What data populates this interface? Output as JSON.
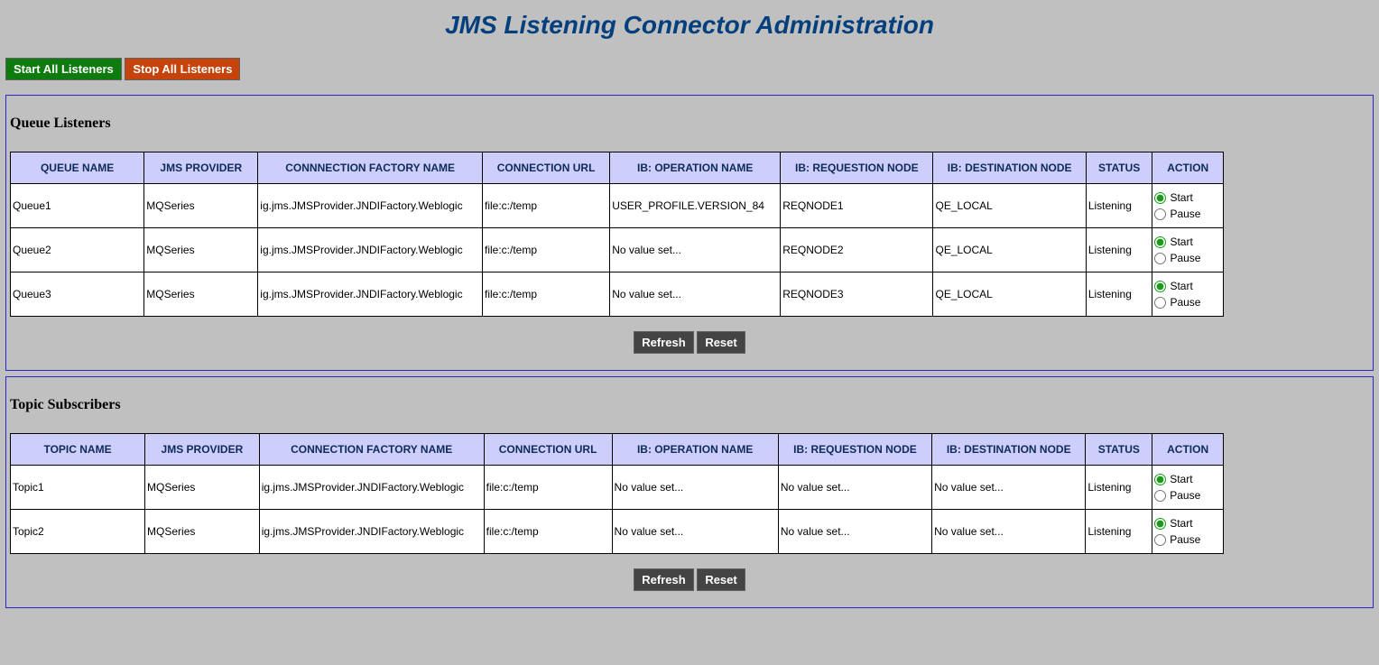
{
  "title": "JMS Listening Connector Administration",
  "buttons": {
    "start_all": "Start All Listeners",
    "stop_all": "Stop All Listeners",
    "refresh": "Refresh",
    "reset": "Reset"
  },
  "action_labels": {
    "start": "Start",
    "pause": "Pause"
  },
  "queue": {
    "title": "Queue Listeners",
    "headers": {
      "name": "QUEUE NAME",
      "provider": "JMS PROVIDER",
      "cfn": "CONNNECTION FACTORY NAME",
      "url": "CONNECTION URL",
      "op": "IB: OPERATION NAME",
      "req": "IB: REQUESTION NODE",
      "dest": "IB: DESTINATION NODE",
      "status": "STATUS",
      "action": "ACTION"
    },
    "rows": [
      {
        "name": "Queue1",
        "provider": "MQSeries",
        "cfn": "ig.jms.JMSProvider.JNDIFactory.Weblogic",
        "url": "file:c:/temp",
        "op": "USER_PROFILE.VERSION_84",
        "req": "REQNODE1",
        "dest": "QE_LOCAL",
        "status": "Listening"
      },
      {
        "name": "Queue2",
        "provider": "MQSeries",
        "cfn": "ig.jms.JMSProvider.JNDIFactory.Weblogic",
        "url": "file:c:/temp",
        "op": "No value set...",
        "req": "REQNODE2",
        "dest": "QE_LOCAL",
        "status": "Listening"
      },
      {
        "name": "Queue3",
        "provider": "MQSeries",
        "cfn": "ig.jms.JMSProvider.JNDIFactory.Weblogic",
        "url": "file:c:/temp",
        "op": "No value set...",
        "req": "REQNODE3",
        "dest": "QE_LOCAL",
        "status": "Listening"
      }
    ]
  },
  "topic": {
    "title": "Topic Subscribers",
    "headers": {
      "name": "TOPIC NAME",
      "provider": "JMS PROVIDER",
      "cfn": "CONNECTION FACTORY NAME",
      "url": "CONNECTION URL",
      "op": "IB: OPERATION NAME",
      "req": "IB: REQUESTION NODE",
      "dest": "IB: DESTINATION NODE",
      "status": "STATUS",
      "action": "ACTION"
    },
    "rows": [
      {
        "name": "Topic1",
        "provider": "MQSeries",
        "cfn": "ig.jms.JMSProvider.JNDIFactory.Weblogic",
        "url": "file:c:/temp",
        "op": "No value set...",
        "req": "No value set...",
        "dest": "No value set...",
        "status": "Listening"
      },
      {
        "name": "Topic2",
        "provider": "MQSeries",
        "cfn": "ig.jms.JMSProvider.JNDIFactory.Weblogic",
        "url": "file:c:/temp",
        "op": "No value set...",
        "req": "No value set...",
        "dest": "No value set...",
        "status": "Listening"
      }
    ]
  }
}
